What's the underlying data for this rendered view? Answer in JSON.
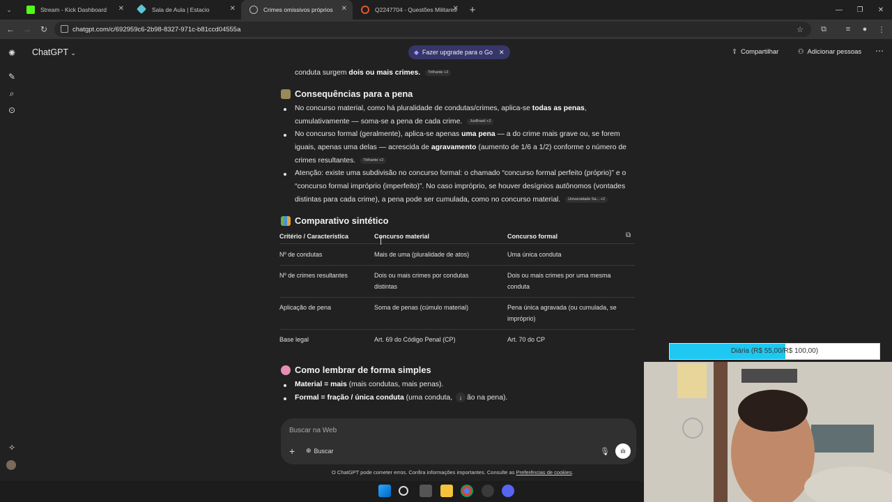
{
  "browser": {
    "tabs": [
      {
        "title": "Stream - Kick Dashboard",
        "favicon_color": "#53fc18"
      },
      {
        "title": "Sala de Aula | Estacio",
        "favicon_color": "#5fc4d6"
      },
      {
        "title": "Crimes omissivos próprios",
        "favicon_color": "#bbbbbb"
      },
      {
        "title": "Q2247704 - Questões Militares",
        "favicon_color": "#e8542f"
      }
    ],
    "url": "chatgpt.com/c/692959c6-2b98-8327-971c-b81ccd04555a"
  },
  "header": {
    "model": "ChatGPT",
    "upgrade_label": "Fazer upgrade para o Go",
    "share_label": "Compartilhar",
    "add_people_label": "Adicionar pessoas"
  },
  "content": {
    "top_line": {
      "pre": "conduta surgem ",
      "bold": "dois ou mais crimes.",
      "cite": "Trilhante +2"
    },
    "section1": {
      "title": "Consequências para a pena",
      "b1": {
        "l1_pre": "No concurso material, como há pluralidade de condutas/crimes, aplica-se ",
        "l1_bold": "todas as penas",
        "l1_post": ",",
        "l2": "cumulativamente — soma-se a pena de cada crime.",
        "cite": "JusBrasil +2"
      },
      "b2": {
        "l1_pre": "No concurso formal (geralmente), aplica-se apenas ",
        "l1_bold": "uma pena",
        "l1_post": " — a do crime mais grave ou, se forem",
        "l2_pre": "iguais, apenas uma delas — acrescida de ",
        "l2_bold": "agravamento",
        "l2_post": " (aumento de 1/6 a 1/2) conforme o número de",
        "l3": "crimes resultantes.",
        "cite": "Trilhante +2"
      },
      "b3": {
        "l1": "Atenção: existe uma subdivisão no concurso formal: o chamado “concurso formal perfeito (próprio)” e o",
        "l2": "“concurso formal impróprio (imperfeito)”. No caso impróprio, se houver desígnios autônomos (vontades",
        "l3": "distintas para cada crime), a pena pode ser cumulada, como no concurso material.",
        "cite": "Universidade Sa... +2"
      }
    },
    "section2": {
      "title": "Comparativo sintético",
      "headers": [
        "Critério / Característica",
        "Concurso material",
        "Concurso formal"
      ],
      "rows": [
        {
          "c1": "Nº de condutas",
          "c2a": "Mais de uma (pluralidade de atos)",
          "c2b": "",
          "c3a": "Uma única conduta",
          "c3b": ""
        },
        {
          "c1": "Nº de crimes resultantes",
          "c2a": "Dois ou mais crimes por condutas",
          "c2b": "distintas",
          "c3a": "Dois ou mais crimes por uma mesma",
          "c3b": "conduta"
        },
        {
          "c1": "Aplicação de pena",
          "c2a": "Soma de penas (cúmulo material)",
          "c2b": "",
          "c3a": "Pena única agravada (ou cumulada, se",
          "c3b": "impróprio)"
        },
        {
          "c1": "Base legal",
          "c2a": "Art. 69 do Código Penal (CP)",
          "c2b": "",
          "c3a": "Art. 70 do CP",
          "c3b": ""
        }
      ]
    },
    "section3": {
      "title": "Como lembrar de forma simples",
      "b1": {
        "bold": "Material = mais",
        "post": " (mais condutas, mais penas)."
      },
      "b2": {
        "bold": "Formal = fração / única conduta",
        "post_a": " (uma conduta, ",
        "post_b": "ão na pena)."
      }
    }
  },
  "composer": {
    "placeholder": "Buscar na Web",
    "search_label": "Buscar"
  },
  "disclaimer": {
    "text": "O ChatGPT pode cometer erros. Confira informações importantes. Consulte as ",
    "link": "Preferências de cookies",
    "end": "."
  },
  "overlay": {
    "goal_text": "Diária (R$ 55,00/R$ 100,00)",
    "goal_progress": 0.55
  },
  "colors": {
    "background": "#212121",
    "upgrade_pill": "#373669",
    "goal_fill": "#1ec8f0"
  }
}
